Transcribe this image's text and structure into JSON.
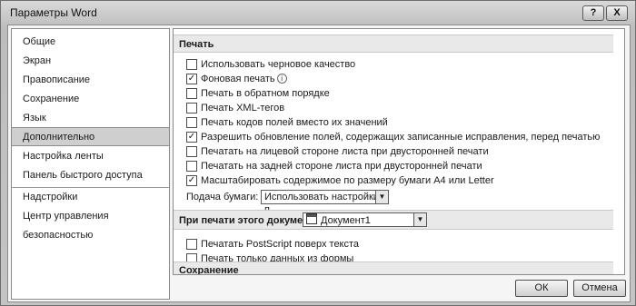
{
  "window": {
    "title": "Параметры Word",
    "help_label": "?",
    "close_label": "X"
  },
  "sidebar": {
    "items": [
      {
        "label": "Общие"
      },
      {
        "label": "Экран"
      },
      {
        "label": "Правописание"
      },
      {
        "label": "Сохранение"
      },
      {
        "label": "Язык"
      },
      {
        "label": "Дополнительно",
        "selected": true
      },
      {
        "label": "Настройка ленты"
      },
      {
        "label": "Панель быстрого доступа"
      },
      {
        "label": "Надстройки"
      },
      {
        "label": "Центр управления безопасностью"
      }
    ]
  },
  "print_section": {
    "title": "Печать",
    "options": [
      {
        "label": "Использовать черновое качество",
        "checked": false
      },
      {
        "label": "Фоновая печать",
        "checked": true,
        "has_info": true
      },
      {
        "label": "Печать в обратном порядке",
        "checked": false
      },
      {
        "label": "Печать XML-тегов",
        "checked": false
      },
      {
        "label": "Печать кодов полей вместо их значений",
        "checked": false
      },
      {
        "label": "Разрешить обновление полей, содержащих записанные исправления, перед печатью",
        "checked": true
      },
      {
        "label": "Печатать на лицевой стороне листа при двусторонней печати",
        "checked": false
      },
      {
        "label": "Печатать на задней стороне листа при двусторонней печати",
        "checked": false
      },
      {
        "label": "Масштабировать содержимое по размеру бумаги А4 или Letter",
        "checked": true
      }
    ],
    "paper_feed_label": "Подача бумаги:",
    "paper_feed_value": "Использовать настройки п..."
  },
  "doc_print_section": {
    "title": "При печати этого документа:",
    "document_value": "Документ1",
    "options": [
      {
        "label": "Печатать PostScript поверх текста",
        "checked": false
      },
      {
        "label": "Печать только данных из формы",
        "checked": false
      }
    ]
  },
  "save_section": {
    "title": "Сохранение"
  },
  "buttons": {
    "ok": "ОК",
    "cancel": "Отмена"
  },
  "icons": {
    "checked_glyph": "✓",
    "info_glyph": "i",
    "dropdown_glyph": "▼",
    "scroll_up_glyph": "▲",
    "scroll_down_glyph": "▼"
  }
}
